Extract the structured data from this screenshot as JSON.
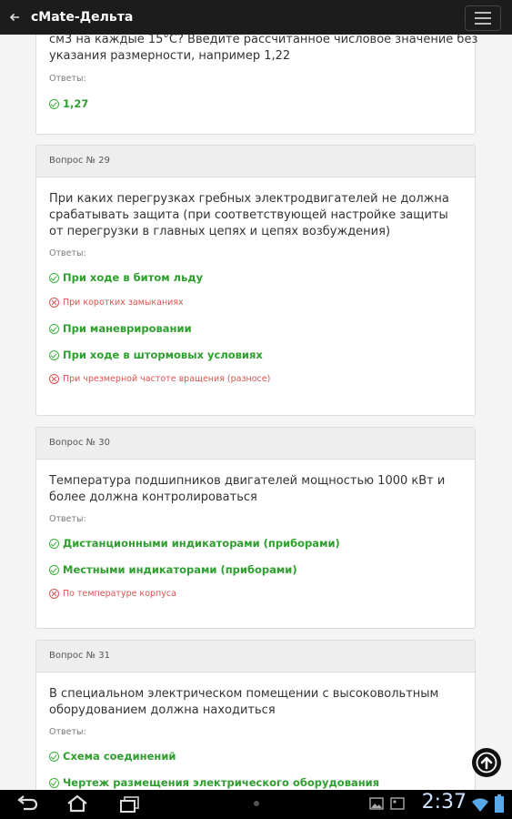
{
  "app": {
    "title": "cMate-Дельта"
  },
  "partial": {
    "question_tail_line1": "см3 на каждые 15°С? Введите рассчитанное числовое значение без",
    "question_tail_line2": "указания размерности, например 1,22",
    "answers_label": "Ответы:",
    "answer": "1,27"
  },
  "cards": [
    {
      "header": "Вопрос № 29",
      "question": "При каких перегрузках гребных электродвигателей не должна срабатывать защита (при соответствующей настройке защиты от перегрузки в главных цепях и цепях возбуждения)",
      "answers_label": "Ответы:",
      "answers": [
        {
          "text": "При ходе в битом льду",
          "correct": true
        },
        {
          "text": "При коротких замыканиях",
          "correct": false
        },
        {
          "text": "При маневрировании",
          "correct": true
        },
        {
          "text": "При ходе в штормовых условиях",
          "correct": true
        },
        {
          "text": "При чрезмерной частоте вращения (разносе)",
          "correct": false
        }
      ]
    },
    {
      "header": "Вопрос № 30",
      "question": "Температура подшипников двигателей мощностью 1000 кВт и более должна контролироваться",
      "answers_label": "Ответы:",
      "answers": [
        {
          "text": "Дистанционными индикаторами (приборами)",
          "correct": true
        },
        {
          "text": "Местными индикаторами (приборами)",
          "correct": true
        },
        {
          "text": "По температуре корпуса",
          "correct": false
        }
      ]
    },
    {
      "header": "Вопрос № 31",
      "question": "В специальном электрическом помещении с высоковольтным оборудованием должна находиться",
      "answers_label": "Ответы:",
      "answers": [
        {
          "text": "Схема соединений",
          "correct": true
        },
        {
          "text": "Чертеж размещения электрического оборудования",
          "correct": true
        }
      ]
    }
  ],
  "statusbar": {
    "time": "2:37"
  },
  "colors": {
    "correct": "#2e9f2e",
    "incorrect": "#d9534f",
    "appbar": "#1c1c1c"
  }
}
